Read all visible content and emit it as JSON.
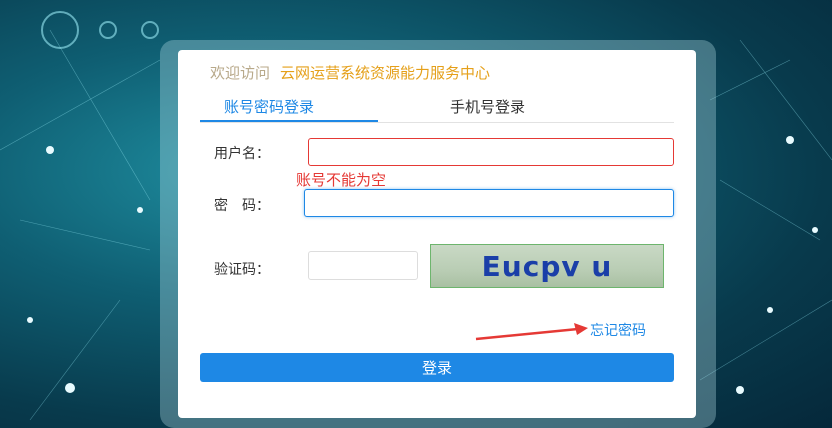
{
  "header": {
    "welcome": "欢迎访问",
    "system_name": "云网运营系统资源能力服务中心"
  },
  "tabs": [
    {
      "label": "账号密码登录",
      "active": true
    },
    {
      "label": "手机号登录",
      "active": false
    }
  ],
  "form": {
    "username_label": "用户名：",
    "username_value": "",
    "username_error": "账号不能为空",
    "password_label": "密　码：",
    "password_value": "",
    "captcha_label": "验证码：",
    "captcha_value": "",
    "captcha_text": "Eucpv u"
  },
  "forgot_label": "忘记密码",
  "login_label": "登录",
  "colors": {
    "accent": "#1e88e5",
    "error": "#e53935",
    "welcome": "#b8a98a",
    "title": "#e5a01a"
  }
}
